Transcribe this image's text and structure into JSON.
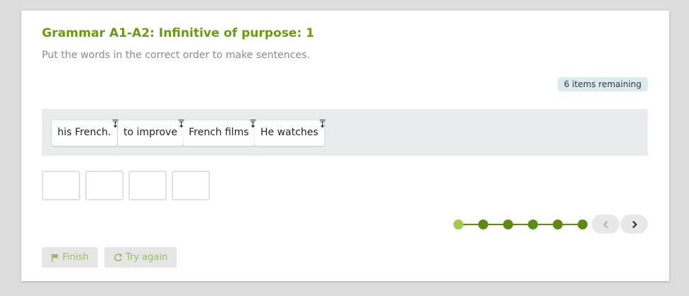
{
  "exercise": {
    "title": "Grammar A1-A2: Infinitive of purpose: 1",
    "instruction": "Put the words in the correct order to make sentences.",
    "remaining_label": "6 items remaining"
  },
  "word_pool": [
    {
      "text": "his French."
    },
    {
      "text": "to improve"
    },
    {
      "text": "French films"
    },
    {
      "text": "He watches"
    }
  ],
  "answer_slots": {
    "count": 4,
    "filled": []
  },
  "pagination": {
    "total_items": 6,
    "current_item": 1
  },
  "buttons": {
    "finish_label": "Finish",
    "try_again_label": "Try again"
  },
  "colors": {
    "accent": "#6a9a12",
    "progress": "#5e8a12",
    "progress_current": "#a6c84b",
    "pool_background": "#e9ecec",
    "badge_background": "#dcebf0"
  },
  "icons": {
    "grip": "drag-handle-icon",
    "prev": "chevron-left-icon",
    "next": "chevron-right-icon",
    "finish": "flag-icon",
    "retry": "refresh-icon"
  }
}
